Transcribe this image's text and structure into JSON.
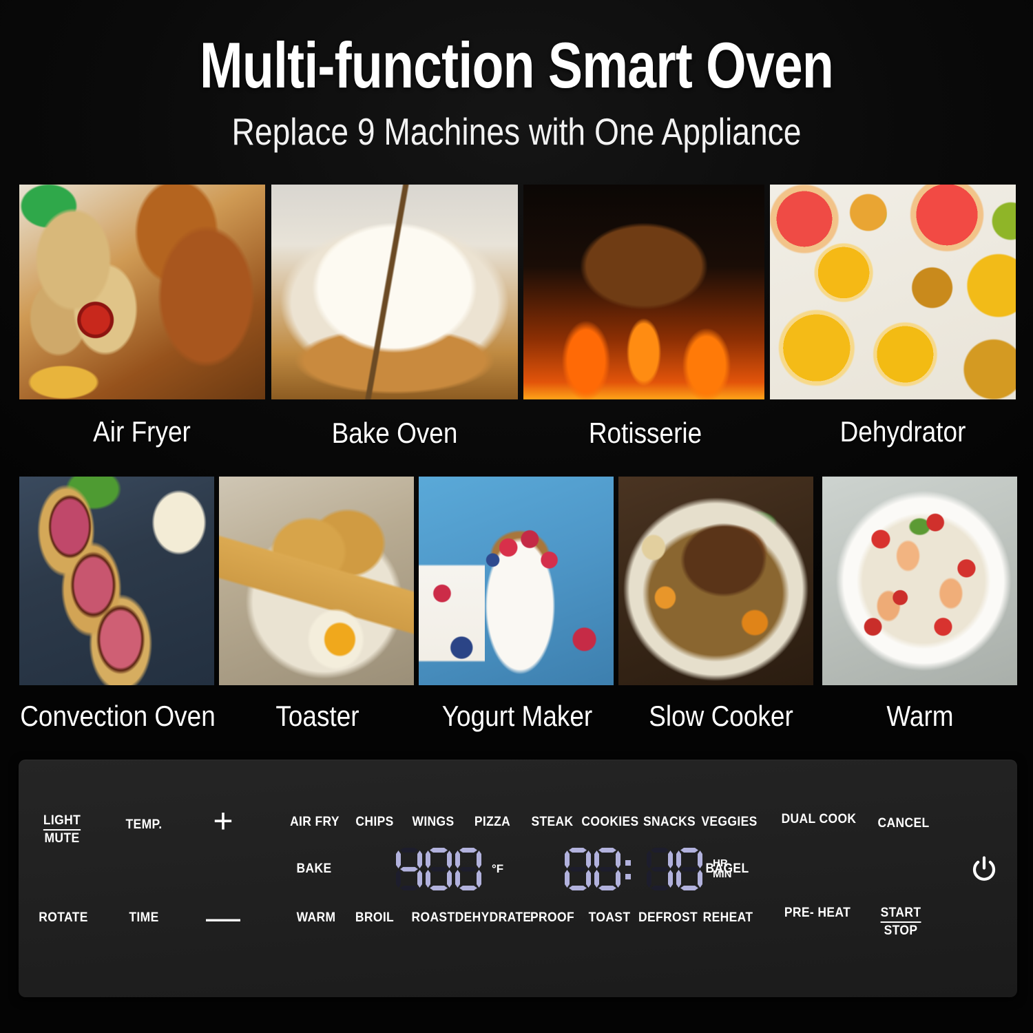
{
  "header": {
    "title": "Multi-function Smart Oven",
    "subtitle": "Replace 9 Machines with One Appliance"
  },
  "colors": {
    "background": "#000000",
    "panel_background": "#222222",
    "led_segment": "#b2b2dd",
    "led_segment_off": "#1d1d2c",
    "text": "#ffffff"
  },
  "functions_grid": {
    "row1": [
      {
        "label": "Air Fryer",
        "art": "art-airfryer"
      },
      {
        "label": "Bake Oven",
        "art": "art-bake"
      },
      {
        "label": "Rotisserie",
        "art": "art-rotisserie"
      },
      {
        "label": "Dehydrator",
        "art": "art-dehydrator"
      }
    ],
    "row2": [
      {
        "label": "Convection Oven",
        "art": "art-convection"
      },
      {
        "label": "Toaster",
        "art": "art-toaster"
      },
      {
        "label": "Yogurt Maker",
        "art": "art-yogurt"
      },
      {
        "label": "Slow Cooker",
        "art": "art-slowcooker"
      },
      {
        "label": "Warm",
        "art": "art-warm"
      }
    ]
  },
  "control_panel": {
    "left_controls": {
      "light_mute": {
        "top": "LIGHT",
        "bottom": "MUTE"
      },
      "rotate": "ROTATE",
      "temp": "TEMP.",
      "time": "TIME",
      "increase": "+",
      "decrease": "—"
    },
    "preset_row_top": [
      "AIR FRY",
      "CHIPS",
      "WINGS",
      "PIZZA",
      "STEAK",
      "COOKIES",
      "SNACKS",
      "VEGGIES"
    ],
    "preset_row_middle": [
      "BAKE",
      "BAGEL"
    ],
    "preset_row_bottom": [
      "WARM",
      "BROIL",
      "ROAST",
      "DEHYDRATE",
      "PROOF",
      "TOAST",
      "DEFROST",
      "REHEAT"
    ],
    "right_controls": {
      "dual_cook": {
        "top": "DUAL",
        "bottom": "COOK"
      },
      "cancel": "CANCEL",
      "pre_heat": {
        "top": "PRE-",
        "bottom": "HEAT"
      },
      "start_stop": {
        "top": "START",
        "bottom": "STOP"
      },
      "power_icon": "power-icon"
    },
    "display": {
      "temperature": {
        "value": "400",
        "digits": [
          "4",
          "0",
          "0"
        ],
        "unit": "°F"
      },
      "timer": {
        "value": "00:10",
        "hours": [
          "0",
          "0"
        ],
        "minutes": [
          "1",
          "0"
        ],
        "separator": ":",
        "unit_top": "HR",
        "unit_bottom": "MIN"
      }
    }
  }
}
